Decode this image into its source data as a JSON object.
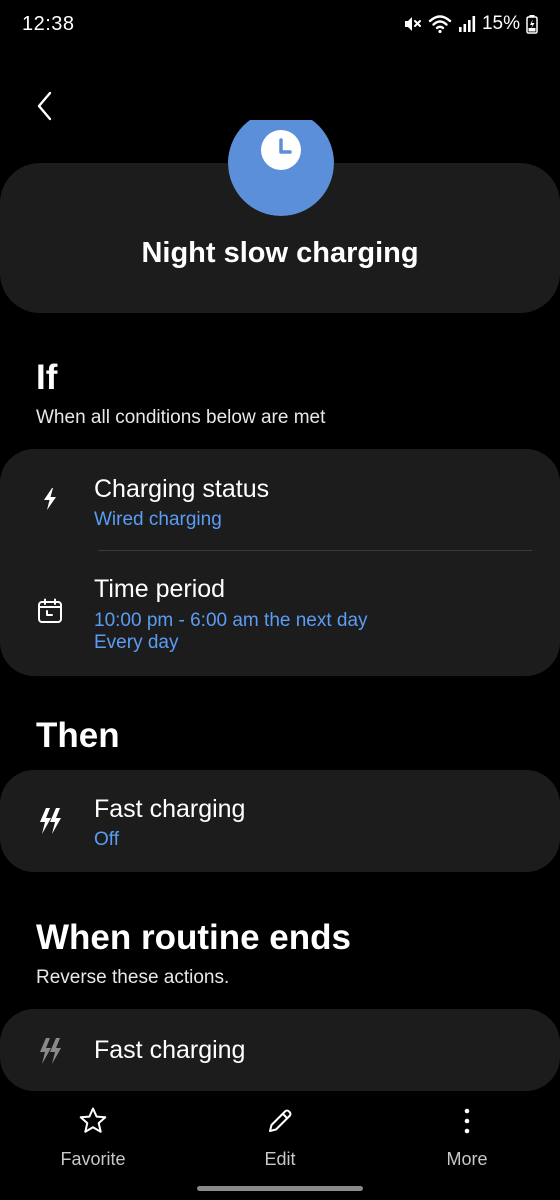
{
  "status_bar": {
    "time": "12:38",
    "battery": "15%",
    "icons": [
      "mute-icon",
      "wifi-icon",
      "signal-icon",
      "battery-charging-icon"
    ]
  },
  "header": {
    "back_icon": "chevron-left-icon",
    "routine_icon": "clock-icon",
    "routine_icon_color": "#5b8fd9",
    "title": "Night slow charging"
  },
  "if_section": {
    "title": "If",
    "subtitle": "When all conditions below are met",
    "conditions": [
      {
        "icon": "bolt-icon",
        "title": "Charging status",
        "values": [
          "Wired charging"
        ]
      },
      {
        "icon": "calendar-clock-icon",
        "title": "Time period",
        "values": [
          "10:00 pm - 6:00 am the next day",
          "Every day"
        ]
      }
    ]
  },
  "then_section": {
    "title": "Then",
    "actions": [
      {
        "icon": "fast-charging-icon",
        "title": "Fast charging",
        "value": "Off"
      }
    ]
  },
  "end_section": {
    "title": "When routine ends",
    "subtitle": "Reverse these actions.",
    "actions": [
      {
        "icon": "fast-charging-icon",
        "title": "Fast charging"
      }
    ]
  },
  "bottom_nav": {
    "favorite": "Favorite",
    "edit": "Edit",
    "more": "More"
  },
  "colors": {
    "background": "#000000",
    "card": "#1c1c1c",
    "accent_value": "#5b9cf5"
  }
}
